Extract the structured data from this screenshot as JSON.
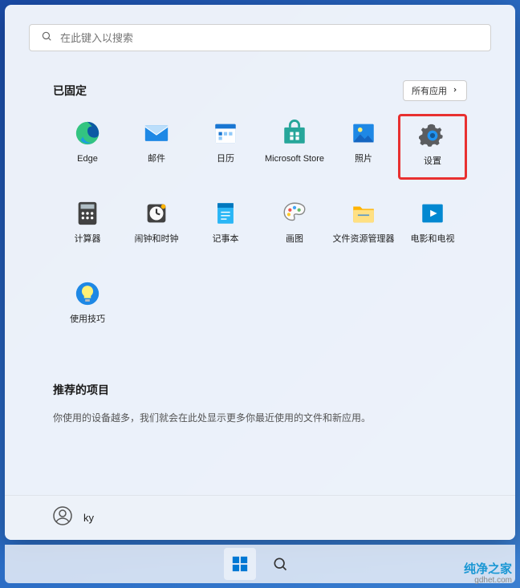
{
  "search": {
    "placeholder": "在此键入以搜索"
  },
  "pinned": {
    "title": "已固定",
    "all_apps_label": "所有应用",
    "tiles": [
      {
        "id": "edge",
        "label": "Edge",
        "icon": "edge-icon"
      },
      {
        "id": "mail",
        "label": "邮件",
        "icon": "mail-icon"
      },
      {
        "id": "calendar",
        "label": "日历",
        "icon": "calendar-icon"
      },
      {
        "id": "store",
        "label": "Microsoft Store",
        "icon": "store-icon"
      },
      {
        "id": "photos",
        "label": "照片",
        "icon": "photos-icon"
      },
      {
        "id": "settings",
        "label": "设置",
        "icon": "settings-icon",
        "highlighted": true
      },
      {
        "id": "calculator",
        "label": "计算器",
        "icon": "calculator-icon"
      },
      {
        "id": "clock",
        "label": "闹钟和时钟",
        "icon": "clock-icon"
      },
      {
        "id": "notepad",
        "label": "记事本",
        "icon": "notepad-icon"
      },
      {
        "id": "paint",
        "label": "画图",
        "icon": "paint-icon"
      },
      {
        "id": "explorer",
        "label": "文件资源管理器",
        "icon": "explorer-icon"
      },
      {
        "id": "movies",
        "label": "电影和电视",
        "icon": "movies-icon"
      },
      {
        "id": "tips",
        "label": "使用技巧",
        "icon": "tips-icon"
      }
    ]
  },
  "recommended": {
    "title": "推荐的项目",
    "empty_text": "你使用的设备越多，我们就会在此处显示更多你最近使用的文件和新应用。"
  },
  "user": {
    "name": "ky"
  },
  "watermark": {
    "line1": "纯净之家",
    "line2": "gdhet.com"
  },
  "colors": {
    "edge": "#0c59a4",
    "mail": "#1e88e5",
    "calendar": "#1976d2",
    "store": "#26a69a",
    "photos": "#1e88e5",
    "settings": "#2a2a2a",
    "calculator": "#424242",
    "clock": "#424242",
    "notepad": "#29b6f6",
    "paint": "#ef5350",
    "explorer": "#ffb300",
    "movies": "#0288d1",
    "tips": "#1e88e5"
  }
}
